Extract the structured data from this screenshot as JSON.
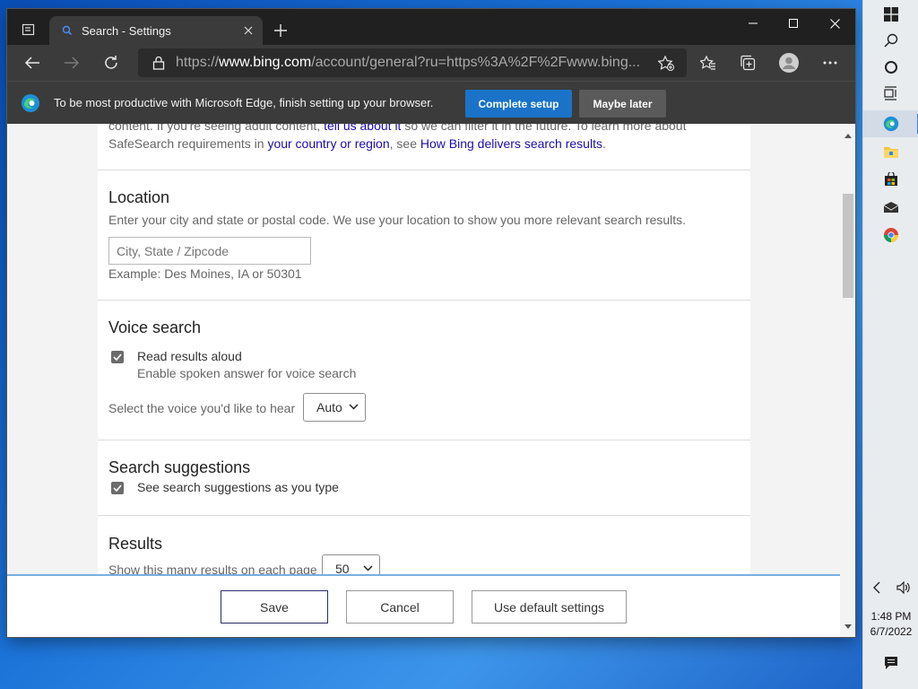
{
  "browser": {
    "tab_title": "Search - Settings",
    "url_prefix": "https://",
    "url_host": "www.bing.com",
    "url_rest": "/account/general?ru=https%3A%2F%2Fwww.bing..."
  },
  "infobar": {
    "message": "To be most productive with Microsoft Edge, finish setting up your browser.",
    "complete_label": "Complete setup",
    "later_label": "Maybe later"
  },
  "safesearch": {
    "line1_a": "content. If you're seeing adult content,",
    "line1_link": "tell us about it",
    "line1_b": "so we can filter it in the future. To learn more about",
    "line2_a": "SafeSearch requirements in",
    "line2_link1": "your country or region",
    "line2_b": ", see",
    "line2_link2": "How Bing delivers search results",
    "line2_c": "."
  },
  "location": {
    "title": "Location",
    "description": "Enter your city and state or postal code. We use your location to show you more relevant search results.",
    "placeholder": "City, State / Zipcode",
    "value": "",
    "example": "Example: Des Moines, IA or 50301"
  },
  "voice": {
    "title": "Voice search",
    "checkbox_label": "Read results aloud",
    "checkbox_checked": true,
    "sub_label": "Enable spoken answer for voice search",
    "select_label": "Select the voice you'd like to hear",
    "select_value": "Auto"
  },
  "suggestions": {
    "title": "Search suggestions",
    "checkbox_label": "See search suggestions as you type",
    "checkbox_checked": true
  },
  "results": {
    "title": "Results",
    "select_label": "Show this many results on each page",
    "select_value": "50"
  },
  "footer": {
    "save": "Save",
    "cancel": "Cancel",
    "default": "Use default settings"
  },
  "taskbar": {
    "time": "1:48 PM",
    "date": "6/7/2022"
  },
  "colors": {
    "accent": "#1a73c8",
    "link": "#1a0dab",
    "titlebar": "#202020",
    "toolbar": "#3b3b3b"
  }
}
